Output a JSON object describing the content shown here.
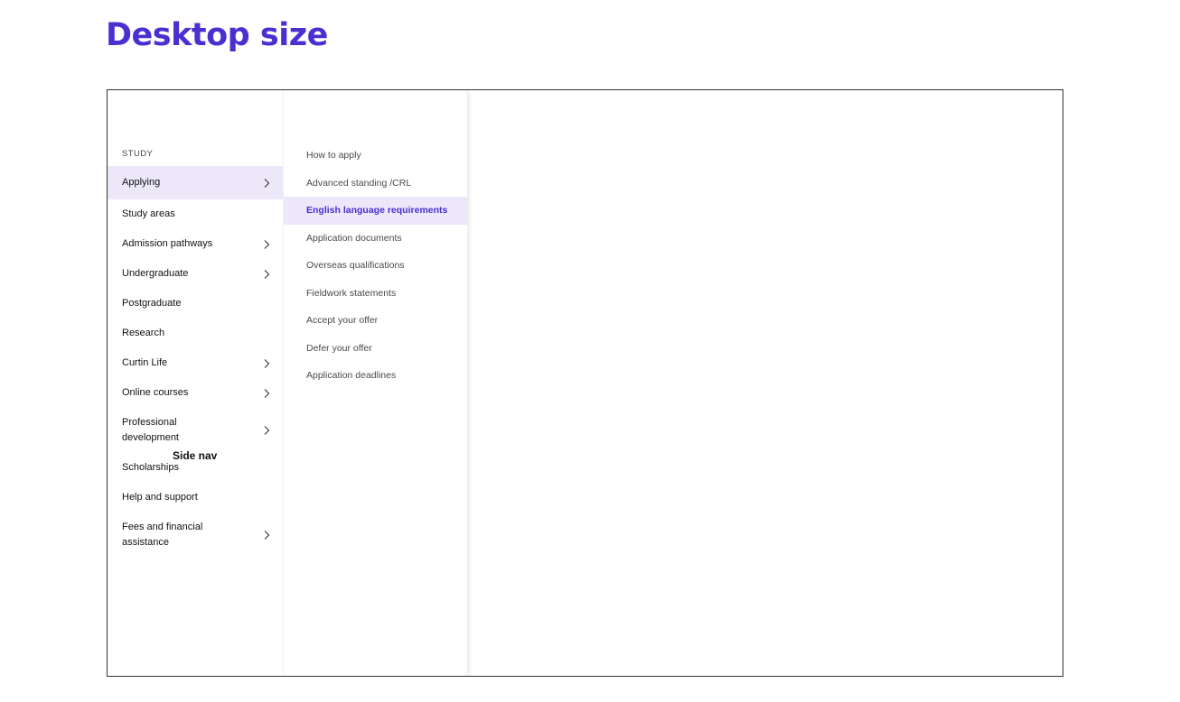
{
  "heading": "Desktop size",
  "side_nav": {
    "section_label": "STUDY",
    "caption": "Side nav",
    "items": [
      {
        "label": "Applying",
        "has_children": true,
        "active": true
      },
      {
        "label": "Study areas",
        "has_children": false
      },
      {
        "label": "Admission pathways",
        "has_children": true
      },
      {
        "label": "Undergraduate",
        "has_children": true
      },
      {
        "label": "Postgraduate",
        "has_children": false
      },
      {
        "label": "Research",
        "has_children": false
      },
      {
        "label": "Curtin Life",
        "has_children": true
      },
      {
        "label": "Online courses",
        "has_children": true
      },
      {
        "label": "Professional development",
        "has_children": true
      },
      {
        "label": "Scholarships",
        "has_children": false
      },
      {
        "label": "Help and support",
        "has_children": false
      },
      {
        "label": "Fees and financial assistance",
        "has_children": true
      }
    ]
  },
  "sub_nav": {
    "items": [
      {
        "label": "How to apply"
      },
      {
        "label": "Advanced standing /CRL"
      },
      {
        "label": "English language requirements",
        "active": true
      },
      {
        "label": "Application documents"
      },
      {
        "label": "Overseas qualifications"
      },
      {
        "label": "Fieldwork statements"
      },
      {
        "label": "Accept your offer"
      },
      {
        "label": "Defer your offer"
      },
      {
        "label": "Application deadlines"
      }
    ]
  },
  "colors": {
    "accent": "#4b2fd0",
    "active_bg": "#ece8fa"
  }
}
